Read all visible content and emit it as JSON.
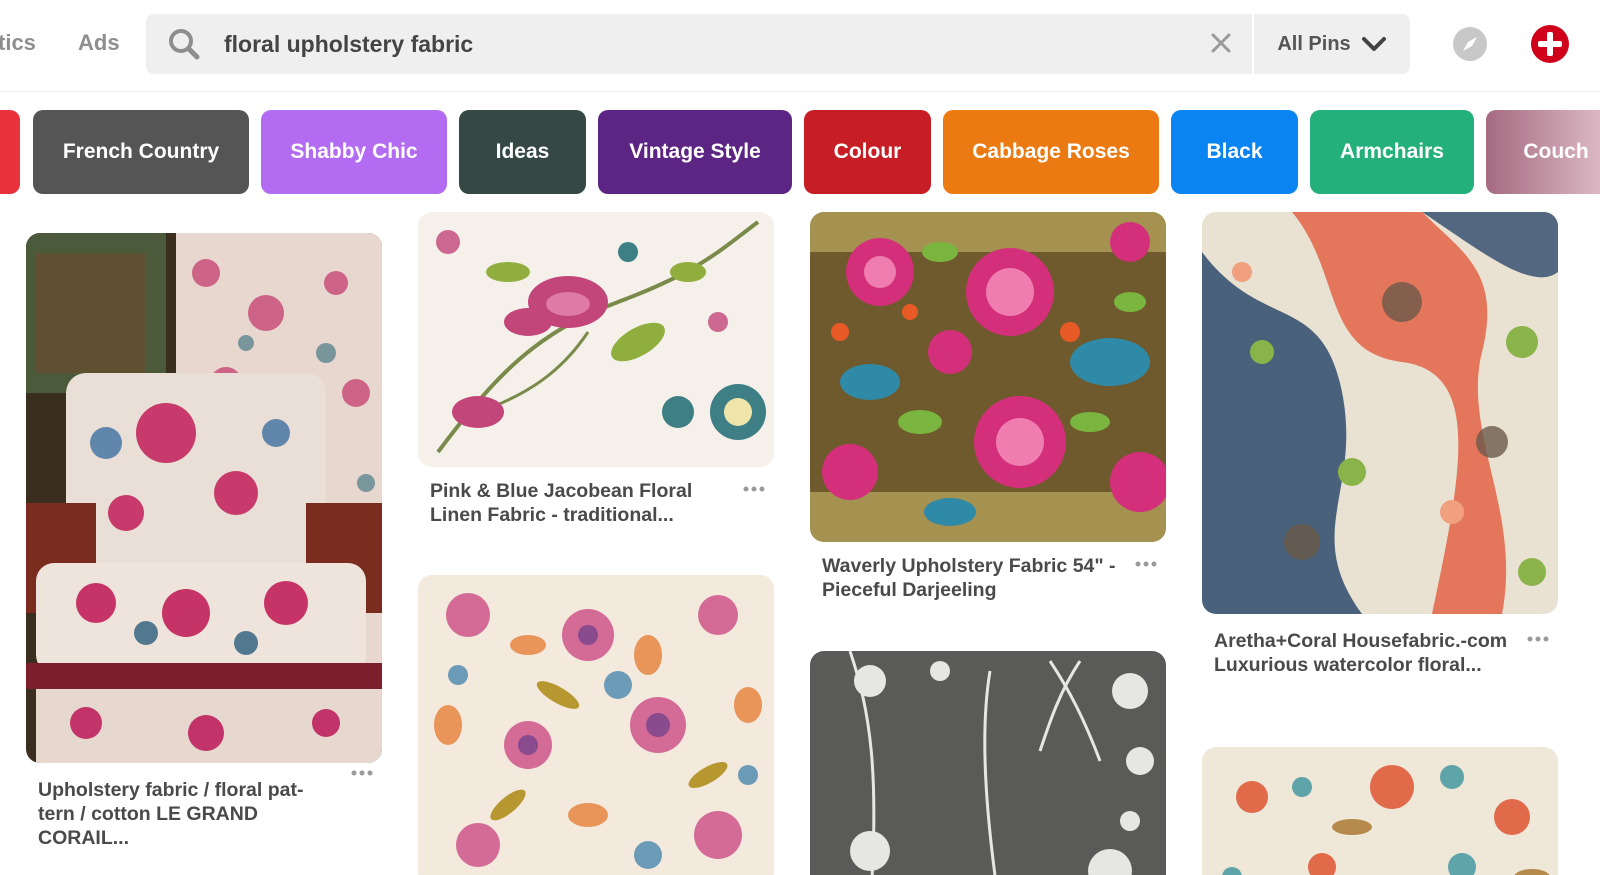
{
  "header": {
    "nav_analytics": "tics",
    "nav_ads": "Ads",
    "search_query": "floral upholstery fabric",
    "filter_label": "All Pins"
  },
  "guides": [
    {
      "label": "",
      "color": "#e9323c"
    },
    {
      "label": "French Country",
      "color": "#555555"
    },
    {
      "label": "Shabby Chic",
      "color": "#b36bf2"
    },
    {
      "label": "Ideas",
      "color": "#354845"
    },
    {
      "label": "Vintage Style",
      "color": "#5c2583"
    },
    {
      "label": "Colour",
      "color": "#c71e25"
    },
    {
      "label": "Cabbage Roses",
      "color": "#ea7a11"
    },
    {
      "label": "Black",
      "color": "#0a84f0"
    },
    {
      "label": "Armchairs",
      "color": "#24b07a"
    },
    {
      "label": "Couch",
      "color": "#a56b80"
    }
  ],
  "pins": [
    {
      "title": "Upholstery fabric / floral pat-tern / cotton LE GRAND CORAIL..."
    },
    {
      "title": "Pink & Blue Jacobean Floral Linen Fabric - traditional..."
    },
    {
      "title": ""
    },
    {
      "title": "Waverly Upholstery Fabric 54\" - Pieceful Darjeeling"
    },
    {
      "title": ""
    },
    {
      "title": "Aretha+Coral Housefabric.-com Luxurious watercolor floral..."
    },
    {
      "title": ""
    }
  ],
  "colors": {
    "brand_red": "#e60023",
    "text_gray": "#8e8e8e",
    "search_bg": "#efefef"
  }
}
